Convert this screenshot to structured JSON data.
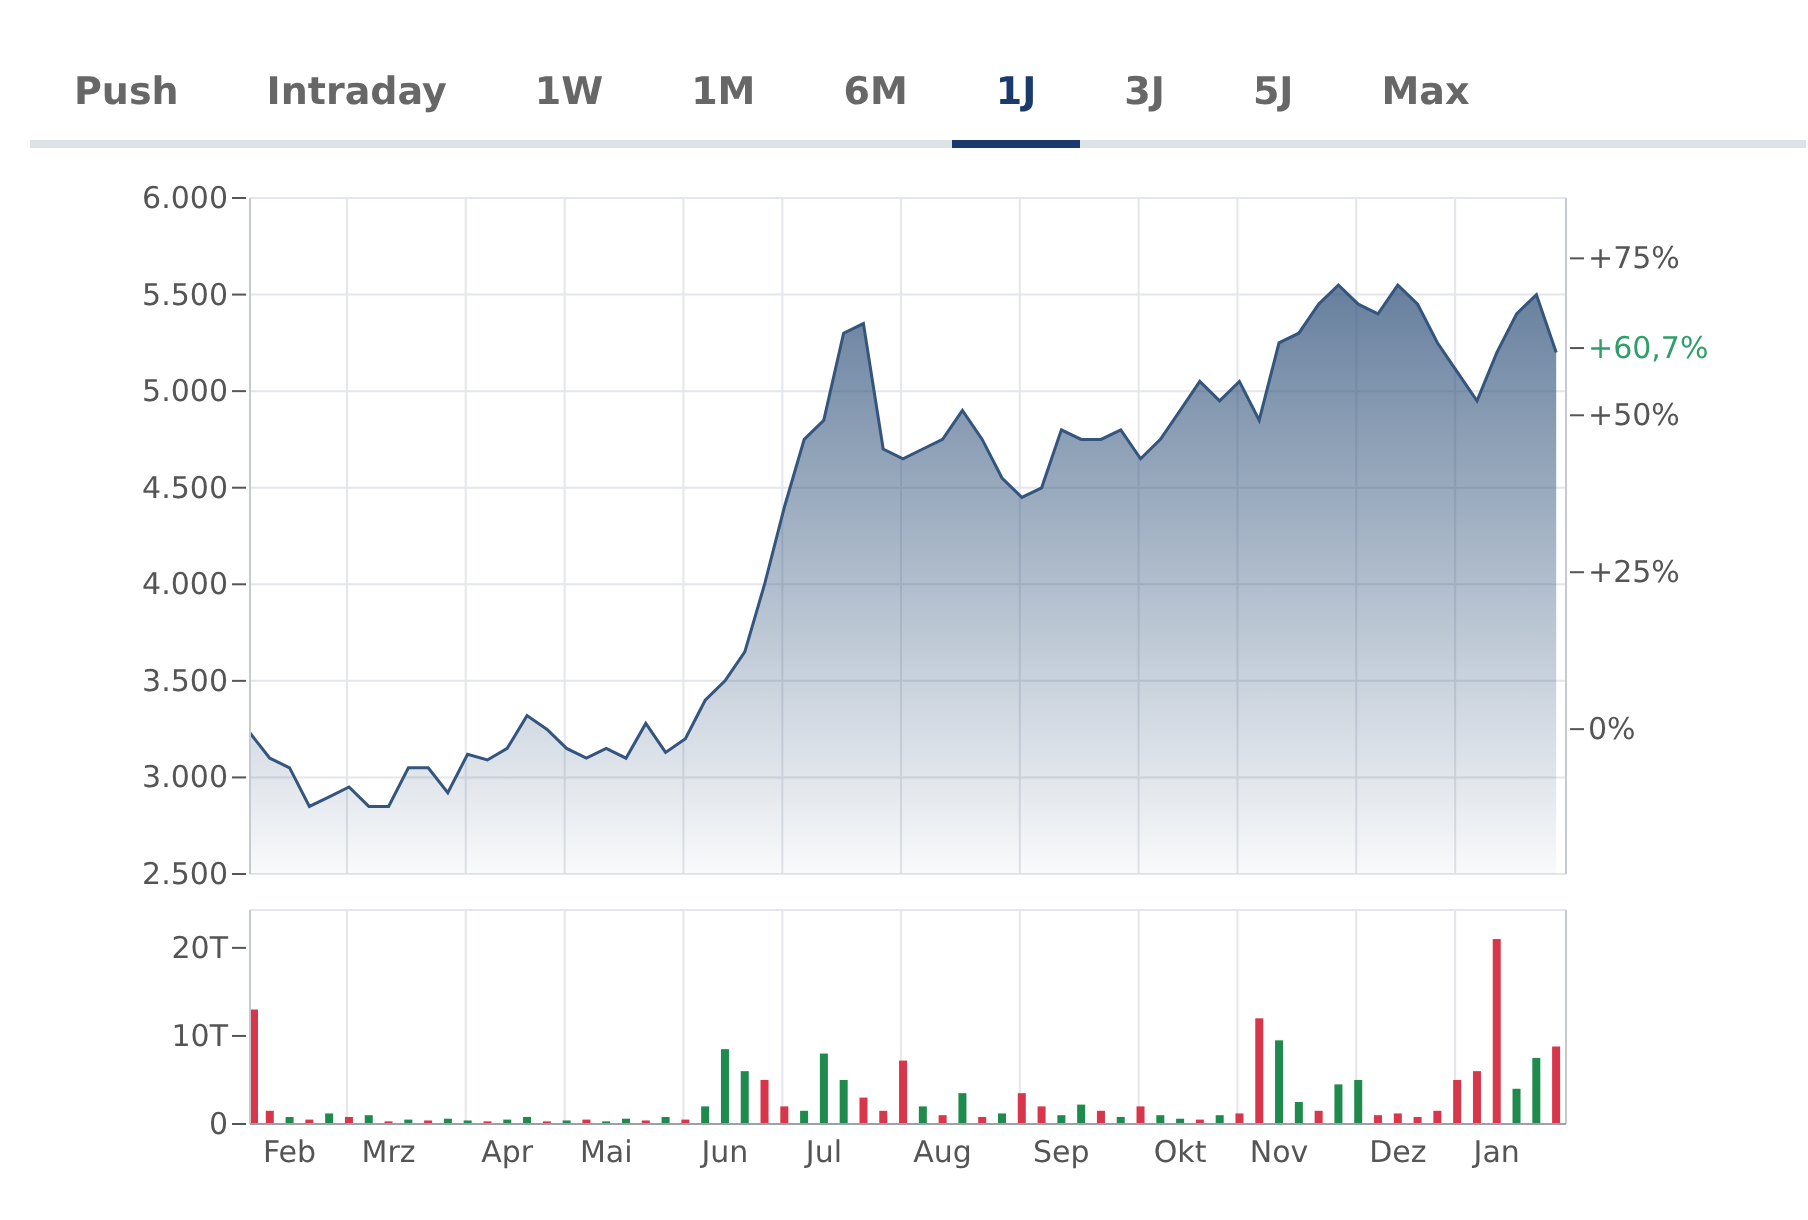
{
  "tabs": [
    {
      "label": "Push",
      "selected": false
    },
    {
      "label": "Intraday",
      "selected": false
    },
    {
      "label": "1W",
      "selected": false
    },
    {
      "label": "1M",
      "selected": false
    },
    {
      "label": "6M",
      "selected": false
    },
    {
      "label": "1J",
      "selected": true
    },
    {
      "label": "3J",
      "selected": false
    },
    {
      "label": "5J",
      "selected": false
    },
    {
      "label": "Max",
      "selected": false
    }
  ],
  "price_chart": {
    "right_axis": [
      {
        "label": "+75%",
        "kind": "tick"
      },
      {
        "label": "+60,7%",
        "kind": "current"
      },
      {
        "label": "+50%",
        "kind": "tick"
      },
      {
        "label": "+25%",
        "kind": "tick"
      },
      {
        "label": "0%",
        "kind": "tick"
      }
    ],
    "chart_data": {
      "type": "area",
      "grid": true,
      "series": [
        {
          "color": "#34557d",
          "values": [
            3230,
            3100,
            3050,
            2850,
            2900,
            2950,
            2850,
            2850,
            3050,
            3050,
            2920,
            3120,
            3090,
            3150,
            3320,
            3250,
            3150,
            3100,
            3150,
            3100,
            3280,
            3130,
            3200,
            3400,
            3500,
            3650,
            4000,
            4400,
            4750,
            4850,
            5300,
            5350,
            4700,
            4650,
            4700,
            4750,
            4900,
            4750,
            4550,
            4450,
            4500,
            4800,
            4750,
            4750,
            4800,
            4650,
            4750,
            4900,
            5050,
            4950,
            5050,
            4850,
            5250,
            5300,
            5450,
            5550,
            5450,
            5400,
            5550,
            5450,
            5250,
            5100,
            4950,
            5200,
            5400,
            5500,
            5200
          ]
        }
      ],
      "ylim": [
        2500,
        6000
      ],
      "yticks": [
        {
          "value": 2500,
          "label": "2.500"
        },
        {
          "value": 3000,
          "label": "3.000"
        },
        {
          "value": 3500,
          "label": "3.500"
        },
        {
          "value": 4000,
          "label": "4.000"
        },
        {
          "value": 4500,
          "label": "4.500"
        },
        {
          "value": 5000,
          "label": "5.000"
        },
        {
          "value": 5500,
          "label": "5.500"
        },
        {
          "value": 6000,
          "label": "6.000"
        }
      ]
    }
  },
  "volume_chart": {
    "chart_data": {
      "type": "bar",
      "stacked": true,
      "grid": true,
      "categories": [
        null,
        null,
        "Feb",
        null,
        null,
        null,
        null,
        "Mrz",
        null,
        null,
        null,
        null,
        null,
        "Apr",
        null,
        null,
        null,
        null,
        "Mai",
        null,
        null,
        null,
        null,
        null,
        "Jun",
        null,
        null,
        null,
        null,
        "Jul",
        null,
        null,
        null,
        null,
        null,
        "Aug",
        null,
        null,
        null,
        null,
        null,
        "Sep",
        null,
        null,
        null,
        null,
        null,
        "Okt",
        null,
        null,
        null,
        null,
        "Nov",
        null,
        null,
        null,
        null,
        null,
        "Dez",
        null,
        null,
        null,
        null,
        "Jan",
        null,
        null,
        null
      ],
      "series": [
        {
          "color": "#1e8a4c",
          "values": [
            null,
            null,
            0.8,
            null,
            1.2,
            null,
            1,
            null,
            0.5,
            null,
            0.6,
            0.4,
            null,
            0.5,
            0.8,
            null,
            0.4,
            null,
            0.3,
            0.6,
            null,
            0.8,
            null,
            2,
            8.5,
            6,
            null,
            null,
            1.5,
            8,
            5,
            null,
            null,
            null,
            2,
            null,
            3.5,
            null,
            1.2,
            null,
            null,
            1,
            2.2,
            null,
            0.8,
            null,
            1,
            0.6,
            null,
            1,
            null,
            null,
            9.5,
            2.5,
            null,
            4.5,
            5,
            null,
            null,
            null,
            null,
            null,
            null,
            null,
            4,
            7.5,
            null
          ]
        },
        {
          "color": "#d8364a",
          "values": [
            13,
            1.5,
            null,
            0.5,
            null,
            0.8,
            null,
            0.3,
            null,
            0.4,
            null,
            null,
            0.3,
            null,
            null,
            0.3,
            null,
            0.5,
            null,
            null,
            0.4,
            null,
            0.5,
            null,
            null,
            null,
            5,
            2,
            null,
            null,
            null,
            3,
            1.5,
            7.2,
            null,
            1,
            null,
            0.8,
            null,
            3.5,
            2,
            null,
            null,
            1.5,
            null,
            2,
            null,
            null,
            0.5,
            null,
            1.2,
            12,
            null,
            null,
            1.5,
            null,
            null,
            1,
            1.2,
            0.8,
            1.5,
            5,
            6,
            21,
            null,
            null,
            8.8
          ]
        }
      ],
      "ylim": [
        0,
        24.3
      ],
      "yticks": [
        {
          "value": 0,
          "label": "0"
        },
        {
          "value": 10,
          "label": "10T"
        },
        {
          "value": 20,
          "label": "20T"
        }
      ]
    }
  }
}
